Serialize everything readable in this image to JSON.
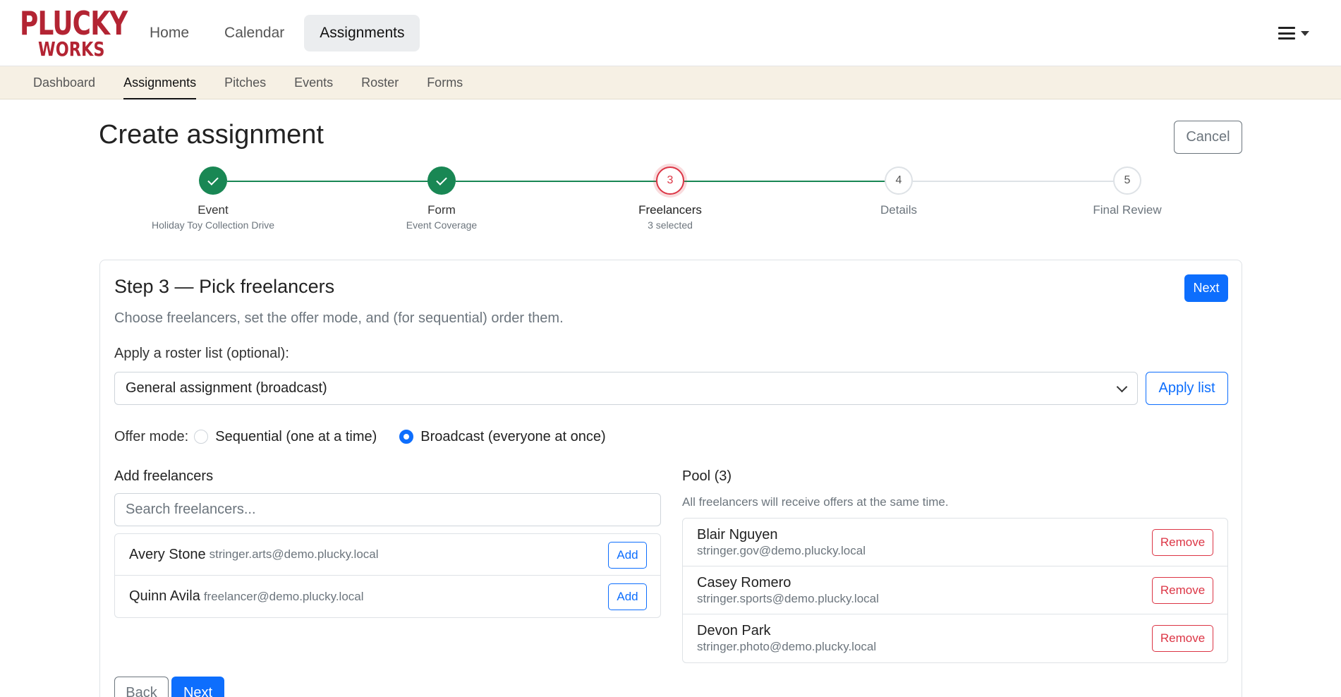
{
  "brand": {
    "line1": "PLUCKY",
    "line2": "WORKS",
    "color": "#b32433"
  },
  "top_nav": [
    {
      "label": "Home",
      "active": false
    },
    {
      "label": "Calendar",
      "active": false
    },
    {
      "label": "Assignments",
      "active": true
    }
  ],
  "menu_icon": "hamburger-icon",
  "sub_nav": [
    {
      "label": "Dashboard",
      "active": false
    },
    {
      "label": "Assignments",
      "active": true
    },
    {
      "label": "Pitches",
      "active": false
    },
    {
      "label": "Events",
      "active": false
    },
    {
      "label": "Roster",
      "active": false
    },
    {
      "label": "Forms",
      "active": false
    }
  ],
  "page": {
    "title": "Create assignment",
    "cancel_label": "Cancel"
  },
  "stepper": [
    {
      "number": "1",
      "label": "Event",
      "sub": "Holiday Toy Collection Drive",
      "state": "done"
    },
    {
      "number": "2",
      "label": "Form",
      "sub": "Event Coverage",
      "state": "done"
    },
    {
      "number": "3",
      "label": "Freelancers",
      "sub": "3 selected",
      "state": "current"
    },
    {
      "number": "4",
      "label": "Details",
      "sub": "",
      "state": "pending"
    },
    {
      "number": "5",
      "label": "Final Review",
      "sub": "",
      "state": "pending"
    }
  ],
  "card": {
    "title": "Step 3 — Pick freelancers",
    "next_label": "Next",
    "description": "Choose freelancers, set the offer mode, and (for sequential) order them.",
    "roster_label": "Apply a roster list (optional):",
    "roster_selected": "General assignment (broadcast)",
    "apply_label": "Apply list",
    "offer_mode_label": "Offer mode:",
    "offer_options": [
      {
        "label": "Sequential (one at a time)",
        "checked": false
      },
      {
        "label": "Broadcast (everyone at once)",
        "checked": true
      }
    ],
    "add_heading": "Add freelancers",
    "search_placeholder": "Search freelancers...",
    "available": [
      {
        "name": "Avery Stone",
        "email": "stringer.arts@demo.plucky.local",
        "action": "Add"
      },
      {
        "name": "Quinn Avila",
        "email": "freelancer@demo.plucky.local",
        "action": "Add"
      }
    ],
    "pool_heading": "Pool (3)",
    "pool_note": "All freelancers will receive offers at the same time.",
    "pool": [
      {
        "name": "Blair Nguyen",
        "email": "stringer.gov@demo.plucky.local",
        "action": "Remove"
      },
      {
        "name": "Casey Romero",
        "email": "stringer.sports@demo.plucky.local",
        "action": "Remove"
      },
      {
        "name": "Devon Park",
        "email": "stringer.photo@demo.plucky.local",
        "action": "Remove"
      }
    ],
    "back_label": "Back",
    "next_bottom_label": "Next"
  },
  "colors": {
    "primary": "#0d6efd",
    "success": "#198754",
    "danger": "#dc3545",
    "subnav_bg": "#f6f0e4"
  }
}
